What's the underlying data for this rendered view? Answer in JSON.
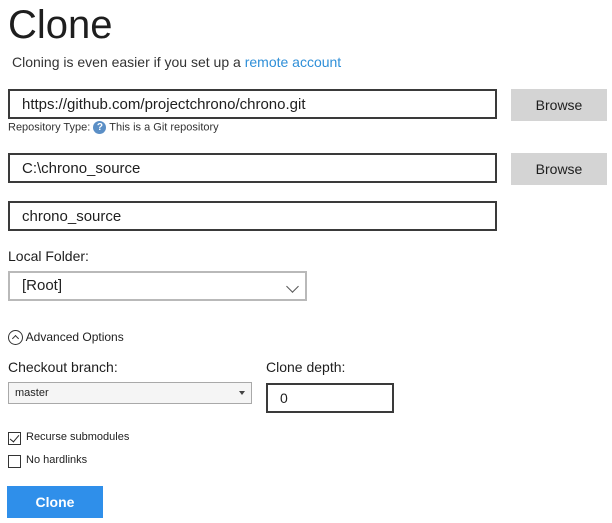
{
  "header": {
    "title": "Clone",
    "subtitle_prefix": "Cloning is even easier if you set up a",
    "subtitle_link": "remote account"
  },
  "repository": {
    "url_value": "https://github.com/projectchrono/chrono.git",
    "browse_label": "Browse",
    "type_label": "Repository Type:",
    "type_value": "This is a Git repository"
  },
  "destination": {
    "path_value": "C:\\chrono_source",
    "browse_label": "Browse",
    "name_value": "chrono_source"
  },
  "local_folder": {
    "label": "Local Folder:",
    "selected": "[Root]"
  },
  "advanced": {
    "toggle_label": "Advanced Options",
    "checkout_branch_label": "Checkout branch:",
    "checkout_branch_selected": "master",
    "clone_depth_label": "Clone depth:",
    "clone_depth_value": "0",
    "recurse_submodules_label": "Recurse submodules",
    "recurse_submodules_checked": true,
    "no_hardlinks_label": "No hardlinks",
    "no_hardlinks_checked": false
  },
  "actions": {
    "clone_label": "Clone"
  },
  "colors": {
    "accent": "#2f8fea",
    "link": "#2f8fd8",
    "secondary_button": "#d4d4d4"
  }
}
